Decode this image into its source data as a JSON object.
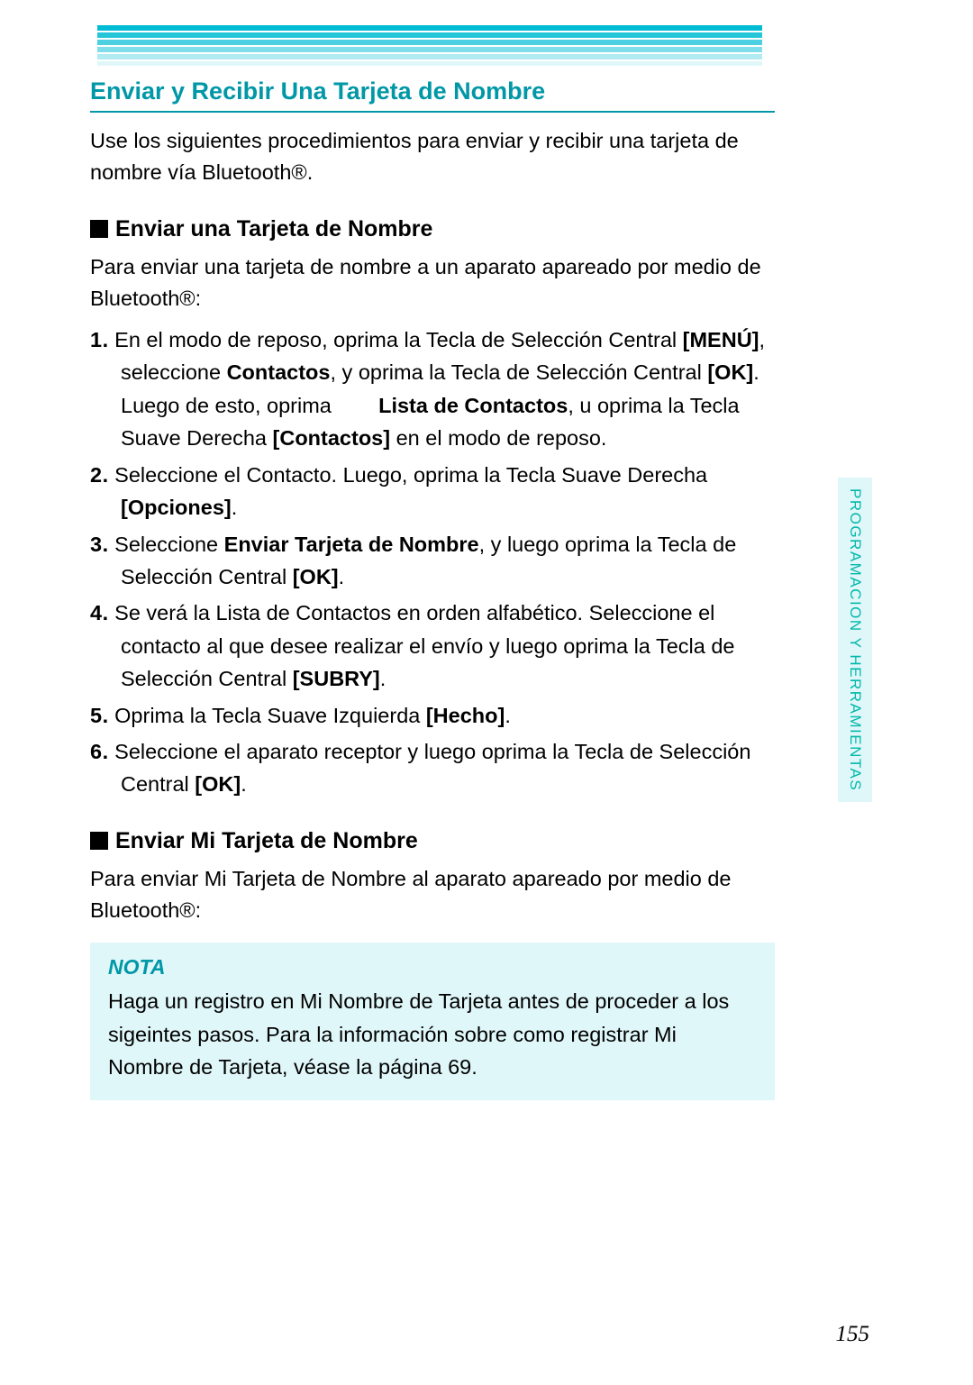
{
  "section_title": "Enviar y Recibir Una Tarjeta de Nombre",
  "intro": "Use los siguientes procedimientos para enviar y recibir una tarjeta de nombre vía Bluetooth®.",
  "sub1": {
    "heading": "Enviar una Tarjeta de Nombre",
    "intro": "Para enviar una tarjeta de nombre a un aparato apareado por medio de Bluetooth®:",
    "steps_html": [
      "En el modo de reposo, oprima la Tecla de Selección Central <b>[MENÚ]</b>, seleccione <b>Contactos</b>, y oprima la Tecla de Selección Central <b>[OK]</b>. Luego de esto, oprima &nbsp;&nbsp;&nbsp;&nbsp;&nbsp;&nbsp; <b>Lista de Contactos</b>, u oprima la Tecla Suave Derecha <b>[Contactos]</b> en el modo de reposo.",
      "Seleccione el Contacto. Luego, oprima la Tecla Suave Derecha <b>[Opciones]</b>.",
      "Seleccione <b>Enviar Tarjeta de Nombre</b>, y luego oprima la Tecla de Selección Central <b>[OK]</b>.",
      "Se verá la Lista de Contactos en orden alfabético. Seleccione el contacto al que desee realizar el envío y luego oprima la Tecla de Selección Central <b>[SUBRY]</b>.",
      "Oprima la Tecla Suave Izquierda <b>[Hecho]</b>.",
      "Seleccione el aparato receptor y luego oprima la Tecla de Selección Central <b>[OK]</b>."
    ]
  },
  "sub2": {
    "heading": "Enviar Mi Tarjeta de Nombre",
    "intro": "Para enviar Mi Tarjeta de Nombre al aparato apareado por medio de Bluetooth®:"
  },
  "note": {
    "label": "NOTA",
    "text": "Haga un registro en Mi Nombre de Tarjeta antes de proceder a los sigeintes pasos. Para la información sobre como registrar Mi Nombre de Tarjeta, véase la página 69."
  },
  "side_tab": "PROGRAMACION Y HERRAMIENTAS",
  "page_number": "155",
  "colors": {
    "teal": "#0097A7",
    "light_teal": "#E0F7FA",
    "accent_text": "#00B8A9"
  }
}
